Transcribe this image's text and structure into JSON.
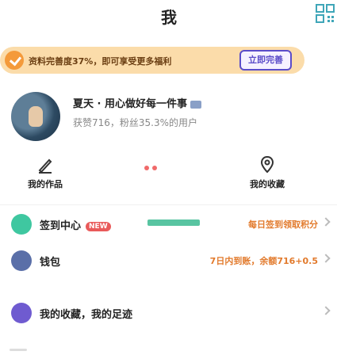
{
  "header": {
    "title": "我",
    "qr_icon": "qr-code-icon"
  },
  "vip_banner": {
    "text": "资料完善度37%，即可享受更多福利",
    "button_label": "立即完善"
  },
  "profile": {
    "name": "夏天",
    "separator": " · ",
    "tagline": "用心做好每一件事",
    "stats": "获赞716，粉丝35.3%的用户"
  },
  "quick_actions": [
    {
      "label": "我的作品",
      "icon": "edit-icon"
    },
    {
      "label": "我的收藏",
      "icon": "location-icon"
    }
  ],
  "menu": [
    {
      "label": "签到中心",
      "badge": "NEW",
      "sub": "每日签到领取积分",
      "icon": "sign-in-icon",
      "color": "#3fc7a0"
    },
    {
      "label": "钱包",
      "sub": "7日内到账，余额716+0.5",
      "icon": "wallet-icon",
      "color": "#5a6fa8"
    },
    {
      "label": "我的收藏，我的足迹",
      "sub": "",
      "icon": "star-icon",
      "color": "#6f5bd0"
    }
  ],
  "colors": {
    "accent_purple": "#5b4cc9",
    "banner_bg": "#fbdcaa",
    "orange": "#e27a2c"
  }
}
